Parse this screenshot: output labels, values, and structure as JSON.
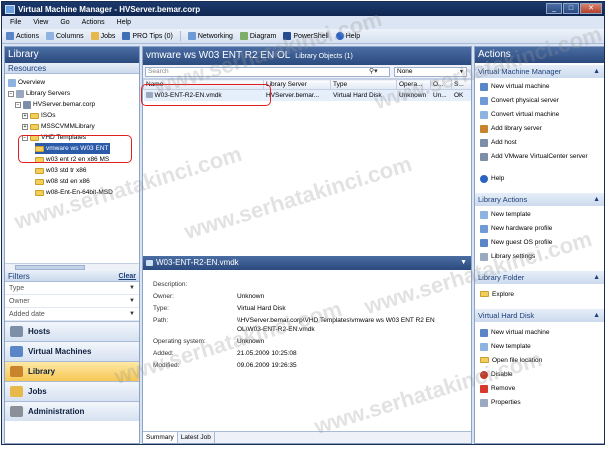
{
  "window": {
    "title": "Virtual Machine Manager - HVServer.bemar.corp",
    "controls": {
      "minimize": "_",
      "maximize": "□",
      "close": "✕"
    }
  },
  "menu": [
    "File",
    "View",
    "Go",
    "Actions",
    "Help"
  ],
  "toolbar": [
    "Actions",
    "Columns",
    "Jobs",
    "PRO Tips (0)",
    "Networking",
    "Diagram",
    "PowerShell",
    "Help"
  ],
  "library": {
    "title": "Library",
    "resources_label": "Resources",
    "tree": [
      {
        "label": "Overview"
      },
      {
        "label": "Library Servers"
      },
      {
        "label": "HVServer.bemar.corp"
      },
      {
        "label": "ISOs"
      },
      {
        "label": "MSSCVMMLibrary"
      },
      {
        "label": "VHD Templates"
      },
      {
        "label": "vmware ws W03 ENT"
      },
      {
        "label": "w03 ent r2 en x86 MS"
      },
      {
        "label": "w03 std tr x86"
      },
      {
        "label": "w08 std en x86"
      },
      {
        "label": "w08-Ent-En-64bit-MSD"
      }
    ],
    "filters": {
      "title": "Filters",
      "clear_label": "Clear",
      "items": [
        "Type",
        "Owner",
        "Added date"
      ]
    },
    "nav": [
      "Hosts",
      "Virtual Machines",
      "Library",
      "Jobs",
      "Administration"
    ]
  },
  "center": {
    "title": "vmware ws W03 ENT R2 EN OL",
    "subtitle": "Library Objects (1)",
    "search_placeholder": "Search",
    "filter_value": "None",
    "columns": [
      "Name",
      "Library Server",
      "Type",
      "Opera...",
      "O...",
      "S..."
    ],
    "rows": [
      [
        "W03-ENT-R2-EN.vmdk",
        "HVServer.bemar...",
        "Virtual Hard Disk",
        "Unknown",
        "Un...",
        "OK"
      ]
    ],
    "details": {
      "title": "W03-ENT-R2-EN.vmdk",
      "fields": [
        {
          "label": "Description:",
          "value": ""
        },
        {
          "label": "Owner:",
          "value": "Unknown"
        },
        {
          "label": "Type:",
          "value": "Virtual Hard Disk"
        },
        {
          "label": "Path:",
          "value": "\\\\HVServer.bemar.corp\\VHD Templates\\vmware ws W03 ENT R2 EN"
        },
        {
          "label": "",
          "value": "OL\\W03-ENT-R2-EN.vmdk"
        },
        {
          "label": "Operating system:",
          "value": "Unknown"
        },
        {
          "label": "Added:",
          "value": "21.05.2009 10:25:08"
        },
        {
          "label": "Modified:",
          "value": "09.06.2009 19:26:35"
        }
      ]
    },
    "tabs": [
      "Summary",
      "Latest Job"
    ]
  },
  "actions": {
    "title": "Actions",
    "sections": [
      {
        "title": "Virtual Machine Manager",
        "items": [
          "New virtual machine",
          "Convert physical server",
          "Convert virtual machine",
          "Add library server",
          "Add host",
          "Add VMware VirtualCenter server",
          "Help"
        ]
      },
      {
        "title": "Library Actions",
        "items": [
          "New template",
          "New hardware profile",
          "New guest OS profile",
          "Library settings"
        ]
      },
      {
        "title": "Library Folder",
        "items": [
          "Explore"
        ]
      },
      {
        "title": "Virtual Hard Disk",
        "items": [
          "New virtual machine",
          "New template",
          "Open file location",
          "Disable",
          "Remove",
          "Properties"
        ]
      }
    ]
  },
  "watermark": "www.serhatakinci.com"
}
